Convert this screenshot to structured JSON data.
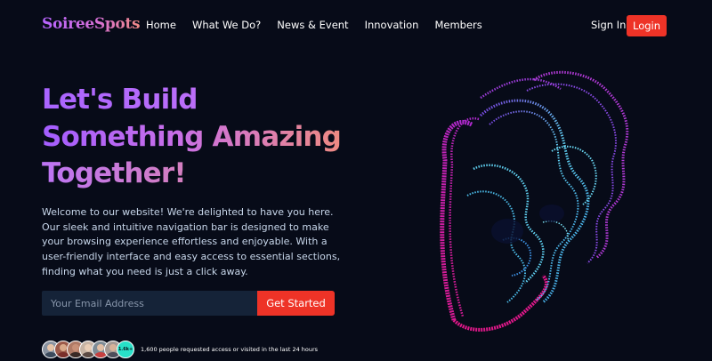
{
  "nav": {
    "logo": "SoireeSpots",
    "links": [
      {
        "label": "Home"
      },
      {
        "label": "What We Do?"
      },
      {
        "label": "News & Event"
      },
      {
        "label": "Innovation"
      },
      {
        "label": "Members"
      }
    ],
    "sign_in": "Sign In",
    "login": "Login"
  },
  "hero": {
    "title_lines": [
      "Let's Build",
      "Something Amazing",
      "Together!"
    ],
    "description": "Welcome to our website! We're delighted to have you here. Our sleek and intuitive navigation bar is designed to make your browsing experience effortless and enjoyable. With a user-friendly interface and easy access to essential sections, finding what you need is just a click away.",
    "email_placeholder": "Your Email Address",
    "cta_label": "Get Started",
    "more_badge": "1.6k+",
    "social_proof": "1,600 people requested access or visited in the last 24 hours"
  },
  "colors": {
    "background": "#070b18",
    "accent_red": "#ee3327",
    "gradient_purple": "#a35dff",
    "gradient_peach": "#ee8a82",
    "art_pink": "#e0188a",
    "art_cyan": "#5fd0f0"
  },
  "art": {
    "icon": "wireframe-face-illustration"
  }
}
